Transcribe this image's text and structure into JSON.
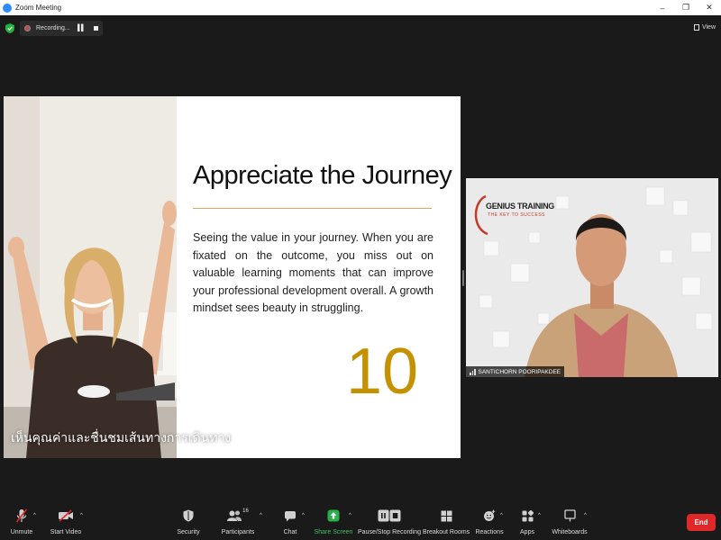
{
  "window": {
    "title": "Zoom Meeting",
    "minimize": "–",
    "restore": "❐",
    "close": "✕"
  },
  "recording": {
    "label": "Recording...",
    "pause": "▌▌"
  },
  "view": {
    "label": "View"
  },
  "slide": {
    "title": "Appreciate the Journey",
    "body": "Seeing the value in your journey. When you are fixated on the outcome, you miss out on valuable learning moments that can improve your professional development overall. A growth mindset sees beauty in struggling.",
    "number": "10",
    "thai_caption": "เห็นคุณค่าและชื่นชมเส้นทางการเดินทาง"
  },
  "speaker": {
    "name": "SANTICHORN POORIPAKDEE",
    "brand_title": "GENIUS TRAINING",
    "brand_tagline": "THE KEY TO SUCCESS"
  },
  "toolbar": {
    "unmute": "Unmute",
    "start_video": "Start Video",
    "security": "Security",
    "participants": "Participants",
    "participant_count": "16",
    "chat": "Chat",
    "share_screen": "Share Screen",
    "pause_stop_recording": "Pause/Stop Recording",
    "breakout_rooms": "Breakout Rooms",
    "reactions": "Reactions",
    "apps": "Apps",
    "whiteboards": "Whiteboards",
    "end": "End",
    "caret": "^"
  },
  "colors": {
    "brand_blue": "#2d8cff",
    "end_red": "#e02828",
    "share_green": "#3cc35c",
    "slide_number_gold": "#c49200",
    "rule_gold": "#d8a85a"
  }
}
